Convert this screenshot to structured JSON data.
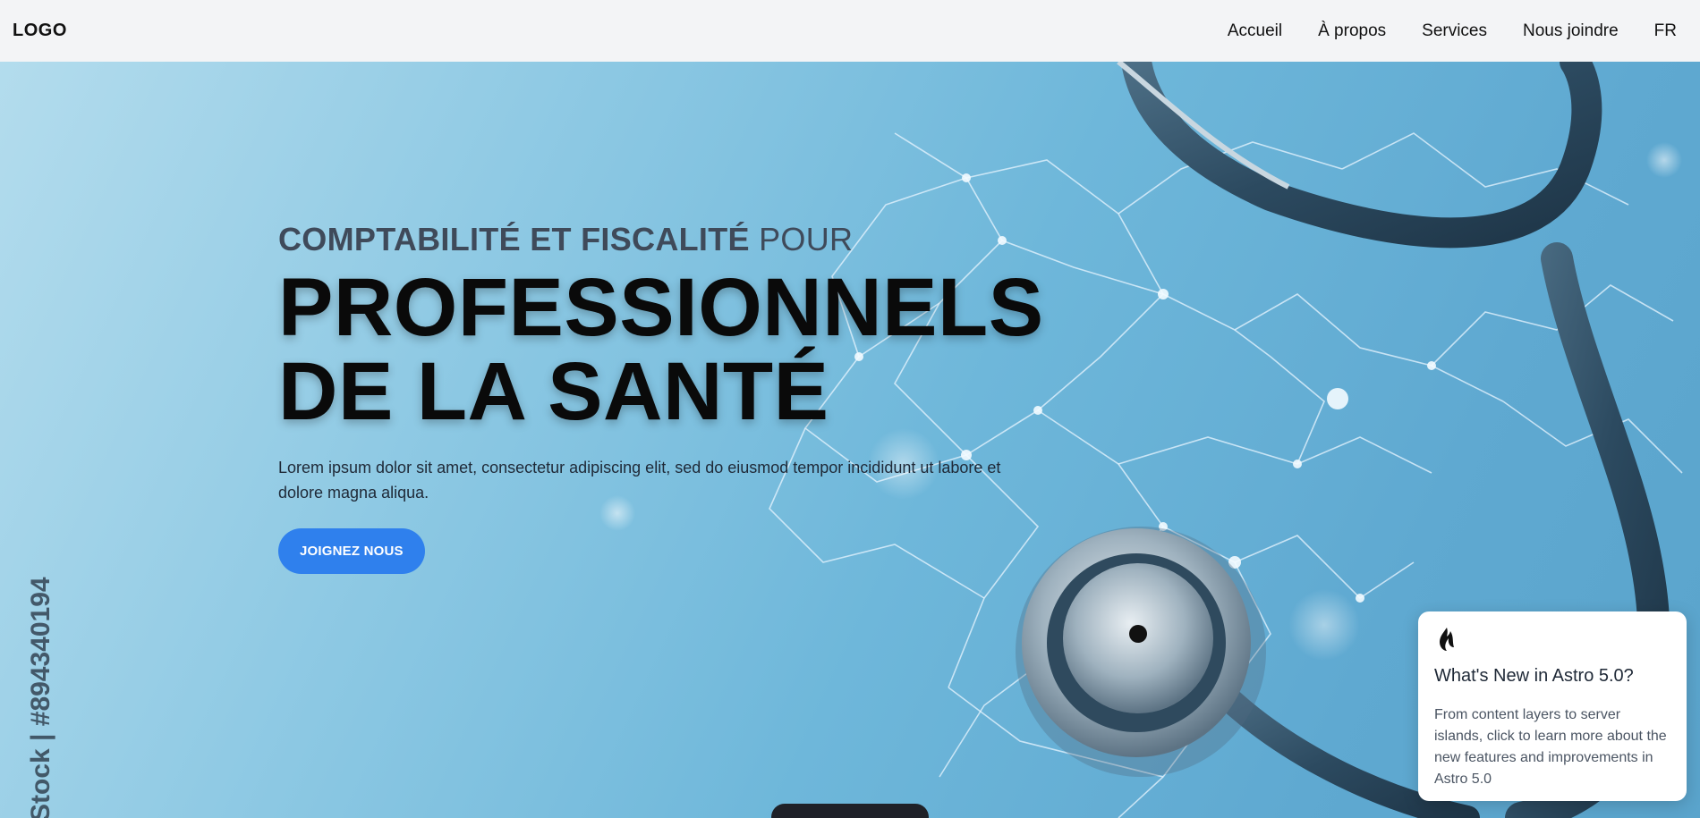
{
  "nav": {
    "logo": "LOGO",
    "links": [
      "Accueil",
      "À propos",
      "Services",
      "Nous joindre",
      "FR"
    ]
  },
  "hero": {
    "kicker_bold": "COMPTABILITÉ ET FISCALITÉ",
    "kicker_light": "POUR",
    "headline_line1": "PROFESSIONNELS",
    "headline_line2": "DE LA SANTÉ",
    "description": "Lorem ipsum dolor sit amet, consectetur adipiscing elit, sed do eiusmod tempor incididunt ut labore et dolore magna aliqua.",
    "cta": "JOIGNEZ NOUS",
    "watermark_text": "Stock | #894340194"
  },
  "toast": {
    "icon": "astro-flame-icon",
    "title": "What's New in Astro 5.0?",
    "body": "From content layers to server islands, click to learn more about the new features and improvements in Astro 5.0"
  },
  "colors": {
    "accent": "#2f80ed",
    "nav_bg": "#f3f4f6",
    "hero_bg": "#6eb7da"
  }
}
